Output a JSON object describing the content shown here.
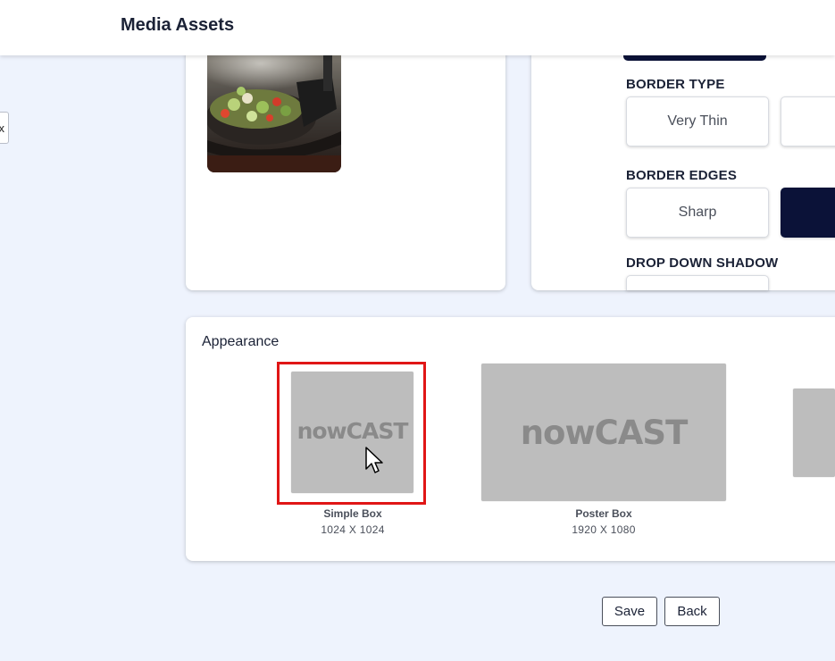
{
  "header": {
    "title": "Media Assets"
  },
  "edge_tab": {
    "label": "x"
  },
  "settings": {
    "border_type": {
      "label": "BORDER TYPE",
      "options": [
        "Very Thin"
      ]
    },
    "border_edges": {
      "label": "BORDER EDGES",
      "options": [
        "Sharp"
      ]
    },
    "drop_down_shadow": {
      "label": "DROP DOWN SHADOW"
    }
  },
  "appearance": {
    "title": "Appearance",
    "items": [
      {
        "name": "Simple Box",
        "size": "1024 X 1024",
        "logo": "nowCAST",
        "selected": true
      },
      {
        "name": "Poster Box",
        "size": "1920 X 1080",
        "logo": "nowCAST",
        "selected": false
      }
    ]
  },
  "footer": {
    "save_label": "Save",
    "back_label": "Back"
  },
  "colors": {
    "accent_dark": "#0b1238",
    "selection": "#e01616",
    "background": "#eef3fd"
  }
}
